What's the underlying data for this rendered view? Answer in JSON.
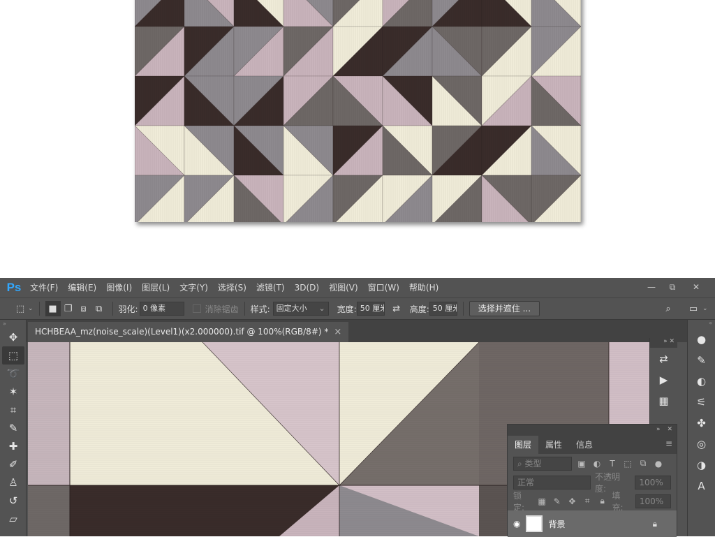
{
  "app": {
    "logo": "Ps"
  },
  "menu": [
    "文件(F)",
    "编辑(E)",
    "图像(I)",
    "图层(L)",
    "文字(Y)",
    "选择(S)",
    "滤镜(T)",
    "3D(D)",
    "视图(V)",
    "窗口(W)",
    "帮助(H)"
  ],
  "window_controls": {
    "minimize": "—",
    "restore": "⧉",
    "close": "✕"
  },
  "options": {
    "feather_label": "羽化:",
    "feather_value": "0 像素",
    "antialias_label": "消除锯齿",
    "style_label": "样式:",
    "style_value": "固定大小",
    "width_label": "宽度:",
    "width_value": "50 厘米",
    "height_label": "高度:",
    "height_value": "50 厘米",
    "select_mask_button": "选择并遮住 ..."
  },
  "document": {
    "tab_title": "HCHBEAA_mz(noise_scale)(Level1)(x2.000000).tif @ 100%(RGB/8#) *",
    "close": "×"
  },
  "layers_panel": {
    "tabs": [
      "图层",
      "属性",
      "信息"
    ],
    "filter_placeholder": "类型",
    "blend_mode": "正常",
    "opacity_label": "不透明度:",
    "opacity_value": "100%",
    "lock_label": "锁定:",
    "fill_label": "填充:",
    "fill_value": "100%",
    "layer_name": "背景"
  },
  "colors": {
    "ui_bg": "#535353",
    "ui_dark": "#424242",
    "accent": "#31a8ff",
    "tile_cream": "#f0ecd9",
    "tile_pink": "#c9b4bc",
    "tile_gray": "#8e8a8f",
    "tile_taupe": "#6e6866",
    "tile_dark": "#3a2c2a"
  }
}
